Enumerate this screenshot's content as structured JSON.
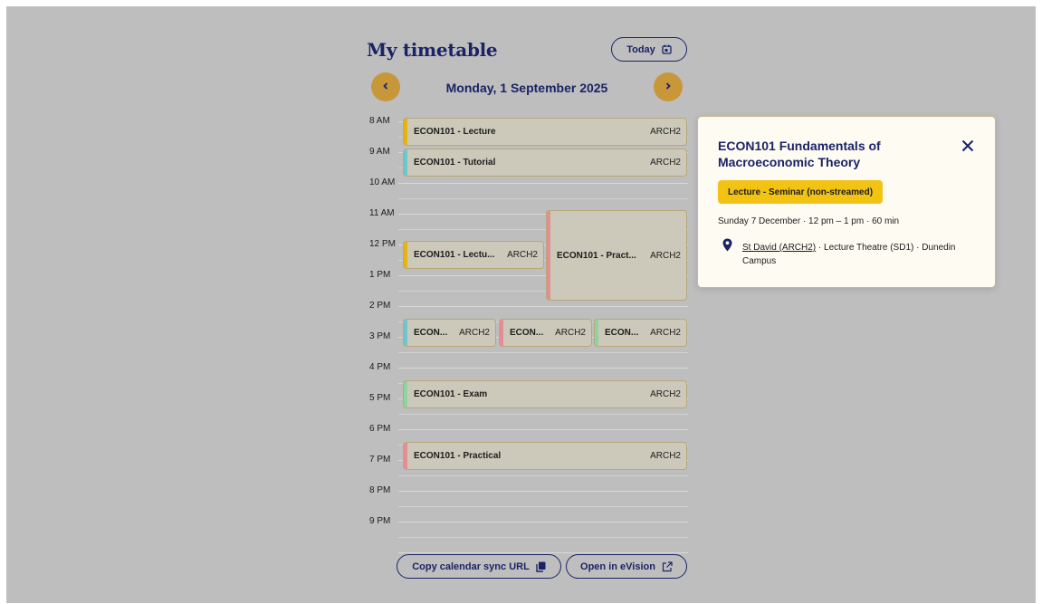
{
  "page": {
    "title": "My timetable",
    "today_label": "Today"
  },
  "nav": {
    "date": "Monday, 1 September 2025"
  },
  "hours": [
    "8 AM",
    "9 AM",
    "10 AM",
    "11 AM",
    "12 PM",
    "1 PM",
    "2 PM",
    "3 PM",
    "4 PM",
    "5 PM",
    "6 PM",
    "7 PM",
    "8 PM",
    "9 PM"
  ],
  "events": [
    {
      "name": "ECON101 - Lecture",
      "room": "ARCH2",
      "color": "#e6b410"
    },
    {
      "name": "ECON101 - Tutorial",
      "room": "ARCH2",
      "color": "#6fc6cc"
    },
    {
      "name": "ECON101 - Lectu...",
      "room": "ARCH2",
      "color": "#e6b410"
    },
    {
      "name": "ECON101 - Pract...",
      "room": "ARCH2",
      "color": "#e58c94"
    },
    {
      "name": "ECON...",
      "room": "ARCH2",
      "color": "#6fc6cc"
    },
    {
      "name": "ECON...",
      "room": "ARCH2",
      "color": "#e58c94"
    },
    {
      "name": "ECON...",
      "room": "ARCH2",
      "color": "#8fd3a0"
    },
    {
      "name": "ECON101 - Exam",
      "room": "ARCH2",
      "color": "#8fd3a0"
    },
    {
      "name": "ECON101 - Practical",
      "room": "ARCH2",
      "color": "#e58c94"
    }
  ],
  "footer": {
    "sync_label": "Copy calendar sync URL",
    "evision_label": "Open in eVision"
  },
  "popup": {
    "title": "ECON101 Fundamentals of Macroeconomic Theory",
    "badge": "Lecture - Seminar (non-streamed)",
    "badge_color": "#f2c313",
    "when": "Sunday 7 December  ·  12 pm – 1 pm  ·  60 min",
    "location_link": "St David (ARCH2)",
    "location_rest": " · Lecture Theatre (SD1) · Dunedin Campus"
  },
  "icons": {
    "today": "calendar-icon",
    "prev": "chevron-left-icon",
    "next": "chevron-right-icon",
    "sync": "copy-icon",
    "evision": "external-link-icon",
    "close": "close-icon",
    "location": "map-pin-icon"
  }
}
